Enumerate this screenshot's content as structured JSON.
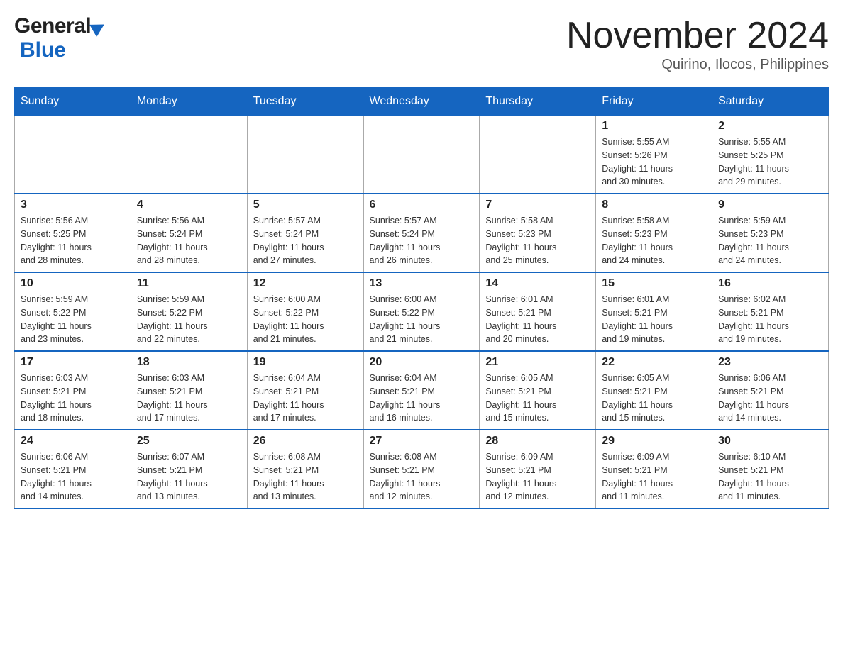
{
  "header": {
    "title": "November 2024",
    "subtitle": "Quirino, Ilocos, Philippines",
    "logo_general": "General",
    "logo_blue": "Blue"
  },
  "weekdays": [
    "Sunday",
    "Monday",
    "Tuesday",
    "Wednesday",
    "Thursday",
    "Friday",
    "Saturday"
  ],
  "weeks": [
    [
      {
        "day": "",
        "info": ""
      },
      {
        "day": "",
        "info": ""
      },
      {
        "day": "",
        "info": ""
      },
      {
        "day": "",
        "info": ""
      },
      {
        "day": "",
        "info": ""
      },
      {
        "day": "1",
        "info": "Sunrise: 5:55 AM\nSunset: 5:26 PM\nDaylight: 11 hours\nand 30 minutes."
      },
      {
        "day": "2",
        "info": "Sunrise: 5:55 AM\nSunset: 5:25 PM\nDaylight: 11 hours\nand 29 minutes."
      }
    ],
    [
      {
        "day": "3",
        "info": "Sunrise: 5:56 AM\nSunset: 5:25 PM\nDaylight: 11 hours\nand 28 minutes."
      },
      {
        "day": "4",
        "info": "Sunrise: 5:56 AM\nSunset: 5:24 PM\nDaylight: 11 hours\nand 28 minutes."
      },
      {
        "day": "5",
        "info": "Sunrise: 5:57 AM\nSunset: 5:24 PM\nDaylight: 11 hours\nand 27 minutes."
      },
      {
        "day": "6",
        "info": "Sunrise: 5:57 AM\nSunset: 5:24 PM\nDaylight: 11 hours\nand 26 minutes."
      },
      {
        "day": "7",
        "info": "Sunrise: 5:58 AM\nSunset: 5:23 PM\nDaylight: 11 hours\nand 25 minutes."
      },
      {
        "day": "8",
        "info": "Sunrise: 5:58 AM\nSunset: 5:23 PM\nDaylight: 11 hours\nand 24 minutes."
      },
      {
        "day": "9",
        "info": "Sunrise: 5:59 AM\nSunset: 5:23 PM\nDaylight: 11 hours\nand 24 minutes."
      }
    ],
    [
      {
        "day": "10",
        "info": "Sunrise: 5:59 AM\nSunset: 5:22 PM\nDaylight: 11 hours\nand 23 minutes."
      },
      {
        "day": "11",
        "info": "Sunrise: 5:59 AM\nSunset: 5:22 PM\nDaylight: 11 hours\nand 22 minutes."
      },
      {
        "day": "12",
        "info": "Sunrise: 6:00 AM\nSunset: 5:22 PM\nDaylight: 11 hours\nand 21 minutes."
      },
      {
        "day": "13",
        "info": "Sunrise: 6:00 AM\nSunset: 5:22 PM\nDaylight: 11 hours\nand 21 minutes."
      },
      {
        "day": "14",
        "info": "Sunrise: 6:01 AM\nSunset: 5:21 PM\nDaylight: 11 hours\nand 20 minutes."
      },
      {
        "day": "15",
        "info": "Sunrise: 6:01 AM\nSunset: 5:21 PM\nDaylight: 11 hours\nand 19 minutes."
      },
      {
        "day": "16",
        "info": "Sunrise: 6:02 AM\nSunset: 5:21 PM\nDaylight: 11 hours\nand 19 minutes."
      }
    ],
    [
      {
        "day": "17",
        "info": "Sunrise: 6:03 AM\nSunset: 5:21 PM\nDaylight: 11 hours\nand 18 minutes."
      },
      {
        "day": "18",
        "info": "Sunrise: 6:03 AM\nSunset: 5:21 PM\nDaylight: 11 hours\nand 17 minutes."
      },
      {
        "day": "19",
        "info": "Sunrise: 6:04 AM\nSunset: 5:21 PM\nDaylight: 11 hours\nand 17 minutes."
      },
      {
        "day": "20",
        "info": "Sunrise: 6:04 AM\nSunset: 5:21 PM\nDaylight: 11 hours\nand 16 minutes."
      },
      {
        "day": "21",
        "info": "Sunrise: 6:05 AM\nSunset: 5:21 PM\nDaylight: 11 hours\nand 15 minutes."
      },
      {
        "day": "22",
        "info": "Sunrise: 6:05 AM\nSunset: 5:21 PM\nDaylight: 11 hours\nand 15 minutes."
      },
      {
        "day": "23",
        "info": "Sunrise: 6:06 AM\nSunset: 5:21 PM\nDaylight: 11 hours\nand 14 minutes."
      }
    ],
    [
      {
        "day": "24",
        "info": "Sunrise: 6:06 AM\nSunset: 5:21 PM\nDaylight: 11 hours\nand 14 minutes."
      },
      {
        "day": "25",
        "info": "Sunrise: 6:07 AM\nSunset: 5:21 PM\nDaylight: 11 hours\nand 13 minutes."
      },
      {
        "day": "26",
        "info": "Sunrise: 6:08 AM\nSunset: 5:21 PM\nDaylight: 11 hours\nand 13 minutes."
      },
      {
        "day": "27",
        "info": "Sunrise: 6:08 AM\nSunset: 5:21 PM\nDaylight: 11 hours\nand 12 minutes."
      },
      {
        "day": "28",
        "info": "Sunrise: 6:09 AM\nSunset: 5:21 PM\nDaylight: 11 hours\nand 12 minutes."
      },
      {
        "day": "29",
        "info": "Sunrise: 6:09 AM\nSunset: 5:21 PM\nDaylight: 11 hours\nand 11 minutes."
      },
      {
        "day": "30",
        "info": "Sunrise: 6:10 AM\nSunset: 5:21 PM\nDaylight: 11 hours\nand 11 minutes."
      }
    ]
  ]
}
